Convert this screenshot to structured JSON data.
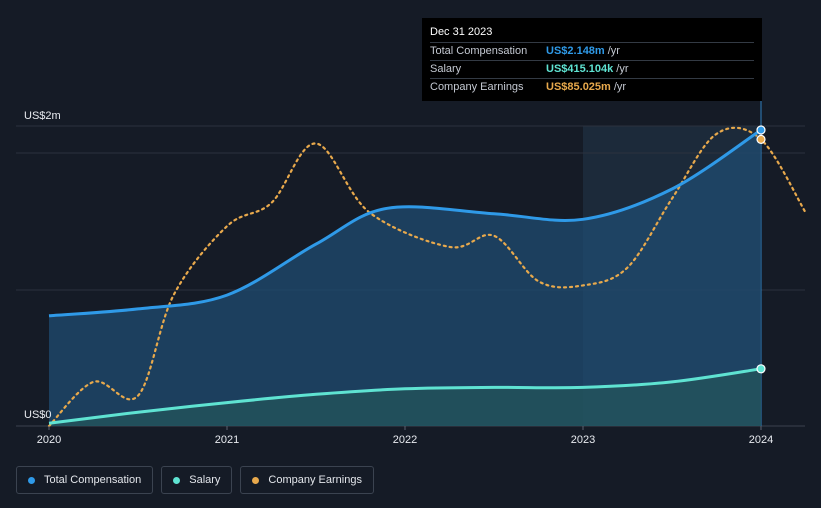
{
  "colors": {
    "total": "#2f9ae8",
    "salary": "#5fe3d2",
    "earnings": "#e8a94c",
    "grid": "#2b323d",
    "background": "#151b26"
  },
  "tooltip": {
    "date": "Dec 31 2023",
    "rows": [
      {
        "label": "Total Compensation",
        "value": "US$2.148m",
        "unit": "/yr",
        "color": "#2f9ae8"
      },
      {
        "label": "Salary",
        "value": "US$415.104k",
        "unit": "/yr",
        "color": "#5fe3d2"
      },
      {
        "label": "Company Earnings",
        "value": "US$85.025m",
        "unit": "/yr",
        "color": "#e8a94c"
      }
    ]
  },
  "legend": [
    {
      "label": "Total Compensation",
      "color": "#2f9ae8"
    },
    {
      "label": "Salary",
      "color": "#5fe3d2"
    },
    {
      "label": "Company Earnings",
      "color": "#e8a94c"
    }
  ],
  "chart_data": {
    "type": "line",
    "title": "",
    "xlabel": "",
    "ylabel": "",
    "y_tick_labels": [
      "US$0",
      "US$2m"
    ],
    "x_tick_labels": [
      "2020",
      "2021",
      "2022",
      "2023",
      "2024"
    ],
    "xlim": [
      2020.0,
      2024.25
    ],
    "ylim": [
      0,
      2.2
    ],
    "grid": true,
    "legend_position": "bottom-left",
    "series": [
      {
        "name": "Total Compensation",
        "unit": "US$m",
        "x": [
          2020.0,
          2020.5,
          2021.0,
          2021.5,
          2021.9,
          2022.5,
          2023.0,
          2023.5,
          2024.0
        ],
        "y": [
          0.8,
          0.85,
          0.95,
          1.32,
          1.58,
          1.54,
          1.5,
          1.72,
          2.148
        ]
      },
      {
        "name": "Salary",
        "unit": "US$m",
        "x": [
          2020.0,
          2020.5,
          2021.0,
          2021.5,
          2022.0,
          2022.5,
          2023.0,
          2023.5,
          2024.0
        ],
        "y": [
          0.02,
          0.1,
          0.17,
          0.23,
          0.27,
          0.28,
          0.28,
          0.32,
          0.415
        ]
      },
      {
        "name": "Company Earnings",
        "unit": "normalized",
        "x": [
          2020.0,
          2020.25,
          2020.5,
          2020.7,
          2021.0,
          2021.25,
          2021.5,
          2021.8,
          2022.25,
          2022.5,
          2022.75,
          2023.0,
          2023.25,
          2023.5,
          2023.75,
          2024.0,
          2024.25
        ],
        "y": [
          0.0,
          0.32,
          0.22,
          0.95,
          1.45,
          1.62,
          2.05,
          1.55,
          1.3,
          1.38,
          1.05,
          1.02,
          1.15,
          1.65,
          2.12,
          2.08,
          1.55
        ]
      }
    ]
  }
}
